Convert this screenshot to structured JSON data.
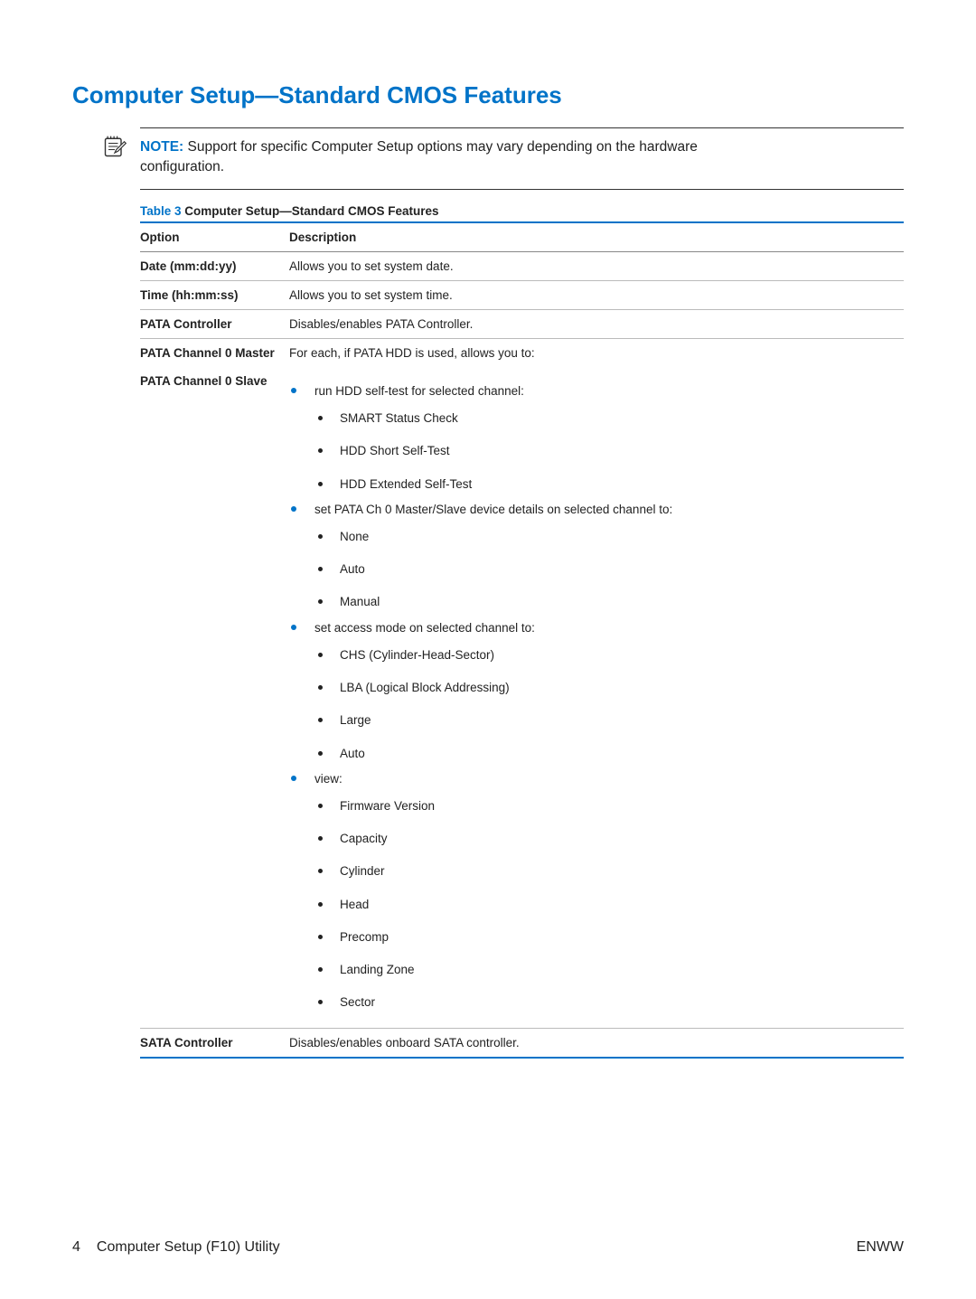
{
  "title": "Computer Setup—Standard CMOS Features",
  "note": {
    "label": "NOTE:",
    "text": "Support for specific Computer Setup options may vary depending on the hardware",
    "text_cont": "configuration."
  },
  "table_caption": {
    "prefix": "Table 3",
    "title": "  Computer Setup—Standard CMOS Features"
  },
  "headers": {
    "option": "Option",
    "description": "Description"
  },
  "rows": {
    "date": {
      "option": "Date (mm:dd:yy)",
      "desc": "Allows you to set system date."
    },
    "time": {
      "option": "Time (hh:mm:ss)",
      "desc": "Allows you to set system time."
    },
    "pata_ctrl": {
      "option": "PATA Controller",
      "desc": "Disables/enables PATA Controller."
    },
    "pata_master": {
      "option": "PATA Channel 0 Master"
    },
    "pata_slave": {
      "option": "PATA Channel 0 Slave"
    },
    "pata_desc_intro": "For each, if PATA HDD is used, allows you to:",
    "sata_ctrl": {
      "option": "SATA Controller",
      "desc": "Disables/enables onboard SATA controller."
    }
  },
  "b1": {
    "text": "run HDD self-test for selected channel:",
    "items": {
      "a": "SMART Status Check",
      "b": "HDD Short Self-Test",
      "c": "HDD Extended Self-Test"
    }
  },
  "b2": {
    "text": "set PATA Ch 0 Master/Slave device details on selected channel to:",
    "items": {
      "a": "None",
      "b": "Auto",
      "c": "Manual"
    }
  },
  "b3": {
    "text": "set access mode on selected channel to:",
    "items": {
      "a": "CHS (Cylinder-Head-Sector)",
      "b": "LBA (Logical Block Addressing)",
      "c": "Large",
      "d": "Auto"
    }
  },
  "b4": {
    "text": "view:",
    "items": {
      "a": "Firmware Version",
      "b": "Capacity",
      "c": "Cylinder",
      "d": "Head",
      "e": "Precomp",
      "f": "Landing Zone",
      "g": "Sector"
    }
  },
  "footer": {
    "page_num": "4",
    "section": "Computer Setup (F10) Utility",
    "right": "ENWW"
  }
}
